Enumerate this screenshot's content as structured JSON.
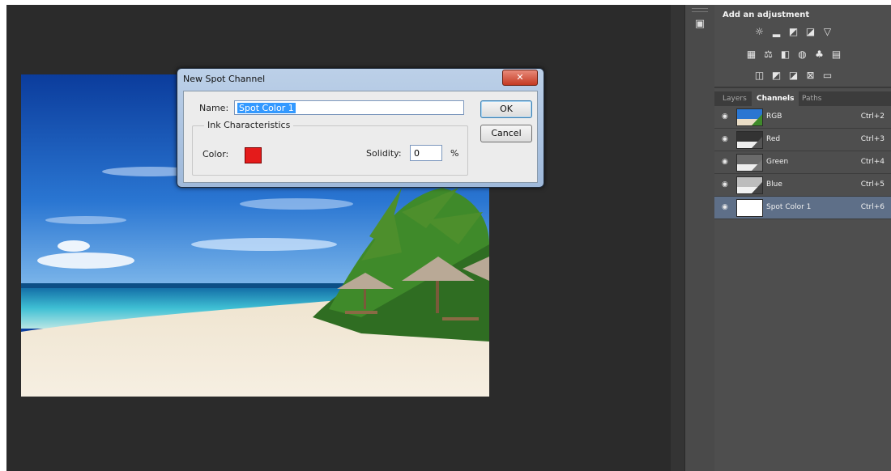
{
  "dialog": {
    "title": "New Spot Channel",
    "close_glyph": "✕",
    "name_label": "Name:",
    "name_value": "Spot Color 1",
    "group_label": "Ink Characteristics",
    "color_label": "Color:",
    "color_value": "#e41b1b",
    "solidity_label": "Solidity:",
    "solidity_value": "0",
    "percent_label": "%",
    "ok_label": "OK",
    "cancel_label": "Cancel"
  },
  "adjustments": {
    "title": "Add an adjustment",
    "icons": [
      "brightness-contrast-icon",
      "levels-icon",
      "curves-icon",
      "exposure-icon",
      "vibrance-icon",
      "hue-saturation-icon",
      "color-balance-icon",
      "black-white-icon",
      "photo-filter-icon",
      "channel-mixer-icon",
      "color-lookup-icon",
      "invert-icon",
      "posterize-icon",
      "threshold-icon",
      "selective-color-icon",
      "gradient-map-icon"
    ]
  },
  "panel": {
    "tabs": [
      {
        "label": "Layers",
        "active": false
      },
      {
        "label": "Channels",
        "active": true
      },
      {
        "label": "Paths",
        "active": false
      }
    ],
    "channels": [
      {
        "name": "RGB",
        "shortcut": "Ctrl+2",
        "selected": false
      },
      {
        "name": "Red",
        "shortcut": "Ctrl+3",
        "selected": false
      },
      {
        "name": "Green",
        "shortcut": "Ctrl+4",
        "selected": false
      },
      {
        "name": "Blue",
        "shortcut": "Ctrl+5",
        "selected": false
      },
      {
        "name": "Spot Color 1",
        "shortcut": "Ctrl+6",
        "selected": true
      }
    ]
  },
  "colors": {
    "workspace": "#2b2b2b",
    "panel": "#4e4e4e",
    "selected_row": "#5e6f88",
    "selection_highlight": "#3399ff"
  }
}
